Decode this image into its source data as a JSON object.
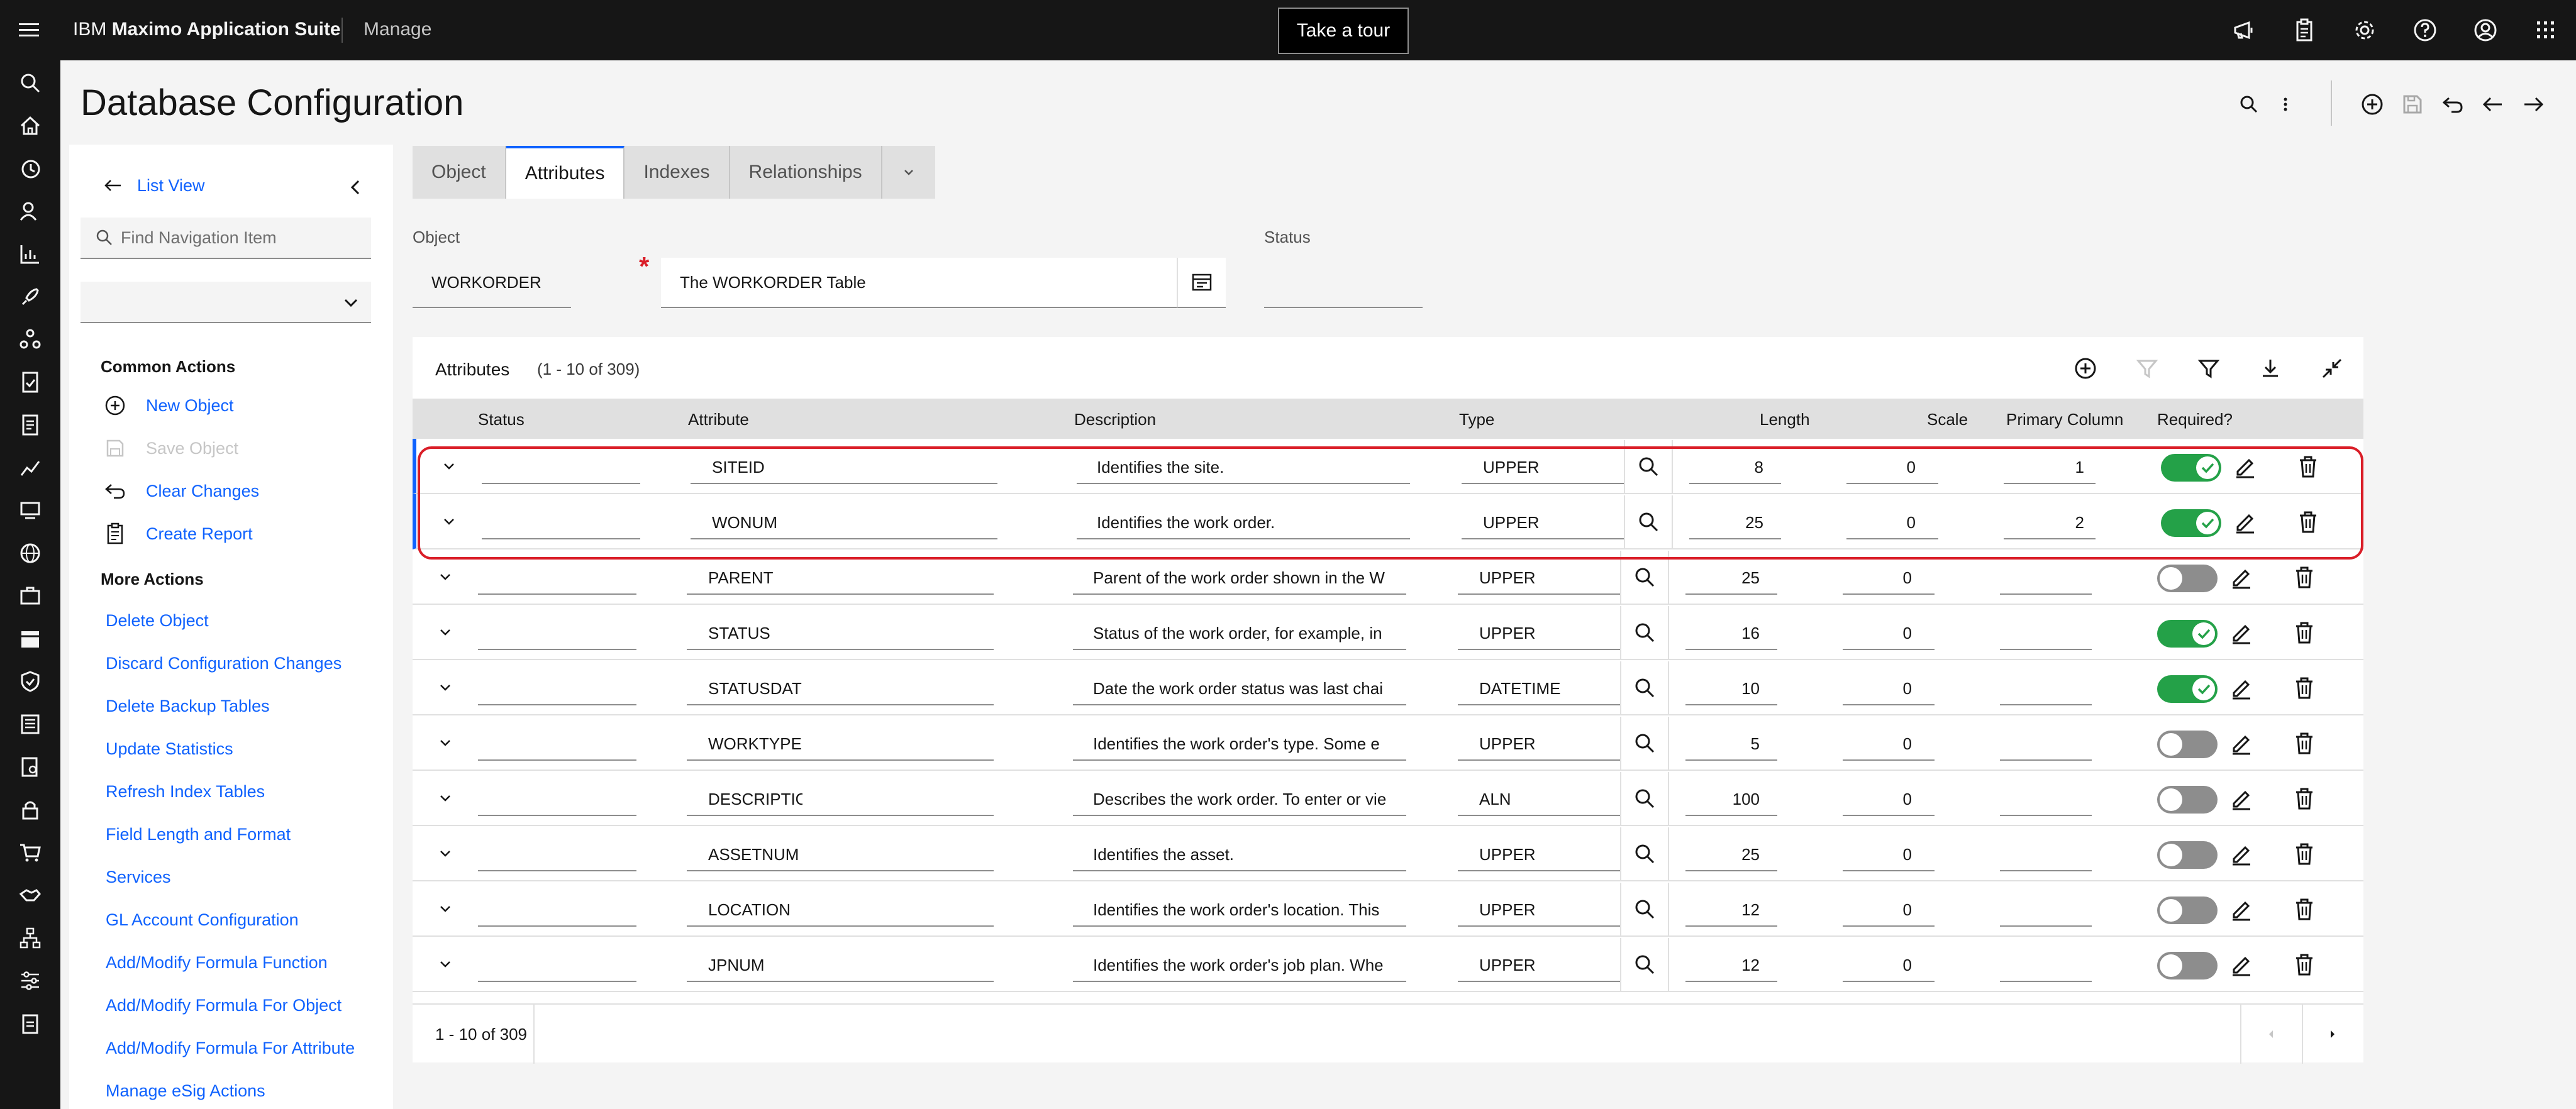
{
  "header": {
    "brand_prefix": "IBM",
    "brand_name": "Maximo Application Suite",
    "app_name": "Manage",
    "tour_label": "Take a tour",
    "icons": [
      "megaphone-icon",
      "clipboard-icon",
      "gear-icon",
      "help-icon",
      "user-icon",
      "app-switcher-icon"
    ]
  },
  "rail": {
    "icons": [
      "search-icon",
      "home-icon",
      "recent-icon",
      "person-icon",
      "chart-icon",
      "rocket-icon",
      "network-icon",
      "document-check-icon",
      "report-icon",
      "line-chart-icon",
      "asset-icon",
      "globe-icon",
      "work-order-icon",
      "calendar-icon",
      "shield-icon",
      "report-list-icon",
      "inspection-icon",
      "lock-icon",
      "cart-icon",
      "handshake-icon",
      "hierarchy-icon",
      "sliders-icon",
      "clipboard-icon"
    ]
  },
  "page": {
    "title": "Database Configuration"
  },
  "sidenav": {
    "list_view": "List View",
    "find_placeholder": "Find Navigation Item",
    "common_actions_heading": "Common Actions",
    "common_actions": [
      {
        "label": "New Object",
        "icon": "add-circle-icon",
        "enabled": true
      },
      {
        "label": "Save Object",
        "icon": "save-icon",
        "enabled": false
      },
      {
        "label": "Clear Changes",
        "icon": "undo-icon",
        "enabled": true
      },
      {
        "label": "Create Report",
        "icon": "report-icon",
        "enabled": true
      }
    ],
    "more_actions_heading": "More Actions",
    "more_actions": [
      "Delete Object",
      "Discard Configuration Changes",
      "Delete Backup Tables",
      "Update Statistics",
      "Refresh Index Tables",
      "Field Length and Format",
      "Services",
      "GL Account Configuration",
      "Add/Modify Formula Function",
      "Add/Modify Formula For Object",
      "Add/Modify Formula For Attribute",
      "Manage eSig Actions"
    ]
  },
  "tabs": [
    "Object",
    "Attributes",
    "Indexes",
    "Relationships"
  ],
  "active_tab": "Attributes",
  "form": {
    "object_label": "Object",
    "object_value": "WORKORDER",
    "description_value": "The WORKORDER Table",
    "status_label": "Status",
    "status_value": ""
  },
  "table": {
    "title": "Attributes",
    "count": "(1 - 10 of 309)",
    "columns": [
      "Status",
      "Attribute",
      "Description",
      "Type",
      "Length",
      "Scale",
      "Primary Column",
      "Required?"
    ],
    "rows": [
      {
        "attribute": "SITEID",
        "description": "Identifies the site.",
        "type": "UPPER",
        "length": "8",
        "scale": "0",
        "primary": "1",
        "required": true
      },
      {
        "attribute": "WONUM",
        "description": "Identifies the work order.",
        "type": "UPPER",
        "length": "25",
        "scale": "0",
        "primary": "2",
        "required": true
      },
      {
        "attribute": "PARENT",
        "description": "Parent of the work order shown in the W",
        "type": "UPPER",
        "length": "25",
        "scale": "0",
        "primary": "",
        "required": false
      },
      {
        "attribute": "STATUS",
        "description": "Status of the work order, for example, in",
        "type": "UPPER",
        "length": "16",
        "scale": "0",
        "primary": "",
        "required": true
      },
      {
        "attribute": "STATUSDATE",
        "description": "Date the work order status was last chai",
        "type": "DATETIME",
        "length": "10",
        "scale": "0",
        "primary": "",
        "required": true
      },
      {
        "attribute": "WORKTYPE",
        "description": "Identifies the work order's type. Some e",
        "type": "UPPER",
        "length": "5",
        "scale": "0",
        "primary": "",
        "required": false
      },
      {
        "attribute": "DESCRIPTION",
        "description": "Describes the work order. To enter or vie",
        "type": "ALN",
        "length": "100",
        "scale": "0",
        "primary": "",
        "required": false
      },
      {
        "attribute": "ASSETNUM",
        "description": "Identifies the asset.",
        "type": "UPPER",
        "length": "25",
        "scale": "0",
        "primary": "",
        "required": false
      },
      {
        "attribute": "LOCATION",
        "description": "Identifies the work order's location. This",
        "type": "UPPER",
        "length": "12",
        "scale": "0",
        "primary": "",
        "required": false
      },
      {
        "attribute": "JPNUM",
        "description": "Identifies the work order's job plan. Whe",
        "type": "UPPER",
        "length": "12",
        "scale": "0",
        "primary": "",
        "required": false
      }
    ],
    "pagination": "1 - 10 of 309"
  },
  "colors": {
    "accent": "#0f62fe",
    "toggle_on": "#24a148",
    "highlight": "#da1e28",
    "header_bg": "#161616"
  }
}
